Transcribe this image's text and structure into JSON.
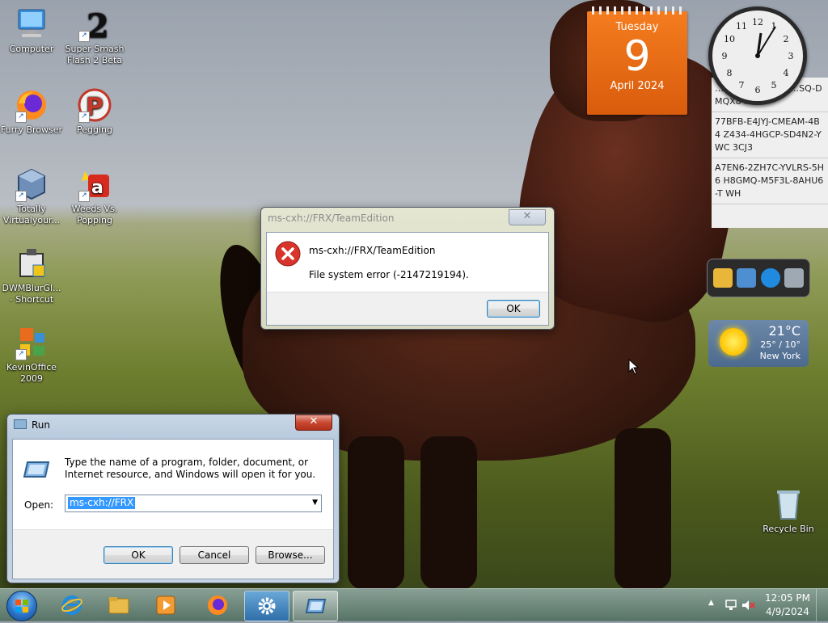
{
  "desktop": {
    "icons": [
      {
        "label": "Computer"
      },
      {
        "label": "Super Smash Flash 2 Beta"
      },
      {
        "label": "Furry Browser"
      },
      {
        "label": "Pegging"
      },
      {
        "label": "Totally Virtualyour..."
      },
      {
        "label": "Weeds Vs. Popping"
      },
      {
        "label": "DWMBlurGl... - Shortcut"
      },
      {
        "label": "KevinOffice 2009"
      },
      {
        "label": "Recycle Bin"
      }
    ]
  },
  "gadgets": {
    "calendar": {
      "dow": "Tuesday",
      "day": "9",
      "month_year": "April 2024"
    },
    "keys": [
      {
        "text": "…WY7-R G-D7… …SQ-DMQX8 MEB"
      },
      {
        "text": "77BFB-E4JYJ-CMEAM-4B4 Z434-4HGCP-SD4N2-YWC 3CJ3"
      },
      {
        "text": "A7EN6-2ZH7C-YVLRS-5H6 H8GMQ-M5F3L-8AHU6-T WH"
      }
    ],
    "weather": {
      "temp": "21°C",
      "range": "25° / 10°",
      "city": "New York"
    }
  },
  "error_dialog": {
    "title": "ms-cxh://FRX/TeamEdition",
    "heading": "ms-cxh://FRX/TeamEdition",
    "message": "File system error (-2147219194).",
    "ok_label": "OK",
    "close_glyph": "✕"
  },
  "run_dialog": {
    "title": "Run",
    "description": "Type the name of a program, folder, document, or Internet resource, and Windows will open it for you.",
    "open_label": "Open:",
    "input_value": "ms-cxh://FRX",
    "ok_label": "OK",
    "cancel_label": "Cancel",
    "browse_label": "Browse...",
    "close_glyph": "✕"
  },
  "taskbar": {
    "time": "12:05 PM",
    "date": "4/9/2024"
  },
  "colors": {
    "calendar": "#e8691a",
    "error_red": "#d9342b",
    "selection": "#3399ff"
  }
}
